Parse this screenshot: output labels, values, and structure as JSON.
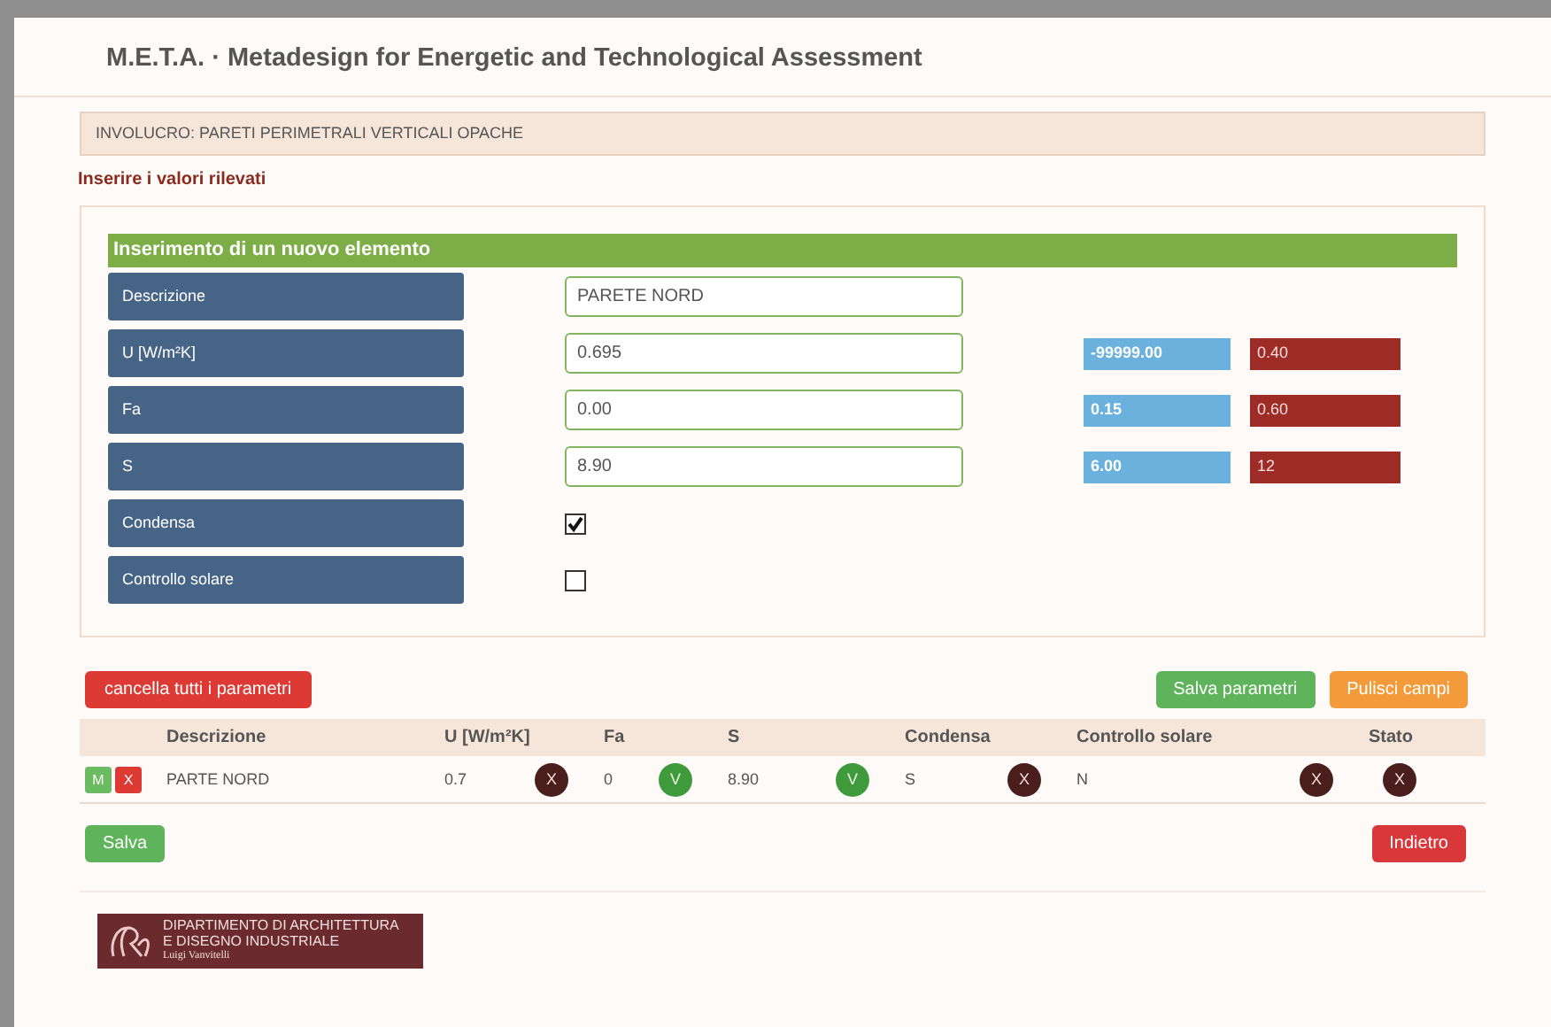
{
  "header": {
    "title": "M.E.T.A. · Metadesign for Energetic and Technological Assessment"
  },
  "section_bar": "INVOLUCRO: PARETI PERIMETRALI VERTICALI OPACHE",
  "instruction": "Inserire i valori rilevati",
  "form": {
    "title": "Inserimento di un nuovo elemento",
    "fields": [
      {
        "kind": "text",
        "label": "Descrizione",
        "value": "PARETE NORD"
      },
      {
        "kind": "text",
        "label": "U [W/m²K]",
        "value": "0.695",
        "min": "-99999.00",
        "max": "0.40"
      },
      {
        "kind": "text",
        "label": "Fa",
        "value": "0.00",
        "min": "0.15",
        "max": "0.60"
      },
      {
        "kind": "text",
        "label": "S",
        "value": "8.90",
        "min": "6.00",
        "max": "12"
      },
      {
        "kind": "checkbox",
        "label": "Condensa",
        "checked": true
      },
      {
        "kind": "checkbox",
        "label": "Controllo solare",
        "checked": false
      }
    ]
  },
  "buttons": {
    "clear_all": "cancella tutti i parametri",
    "save_params": "Salva parametri",
    "clear_fields": "Pulisci campi",
    "save": "Salva",
    "back": "Indietro"
  },
  "table": {
    "columns": [
      "Descrizione",
      "U [W/m²K]",
      "Fa",
      "S",
      "Condensa",
      "Controllo solare",
      "Stato"
    ],
    "rows": [
      {
        "edit": "M",
        "delete": "X",
        "cells": [
          {
            "value": "PARTE NORD"
          },
          {
            "value": "0.7",
            "mark": "X",
            "passed": false
          },
          {
            "value": "0",
            "mark": "V",
            "passed": true
          },
          {
            "value": "8.90",
            "mark": "V",
            "passed": true
          },
          {
            "value": "S",
            "mark": "X",
            "passed": false
          },
          {
            "value": "N",
            "mark": "X",
            "passed": false
          },
          {
            "mark": "X",
            "passed": false
          }
        ]
      }
    ]
  },
  "logo": {
    "lines": [
      "DIPARTIMENTO DI ARCHITETTURA",
      "E DISEGNO INDUSTRIALE",
      "Luigi Vanvitelli"
    ]
  }
}
